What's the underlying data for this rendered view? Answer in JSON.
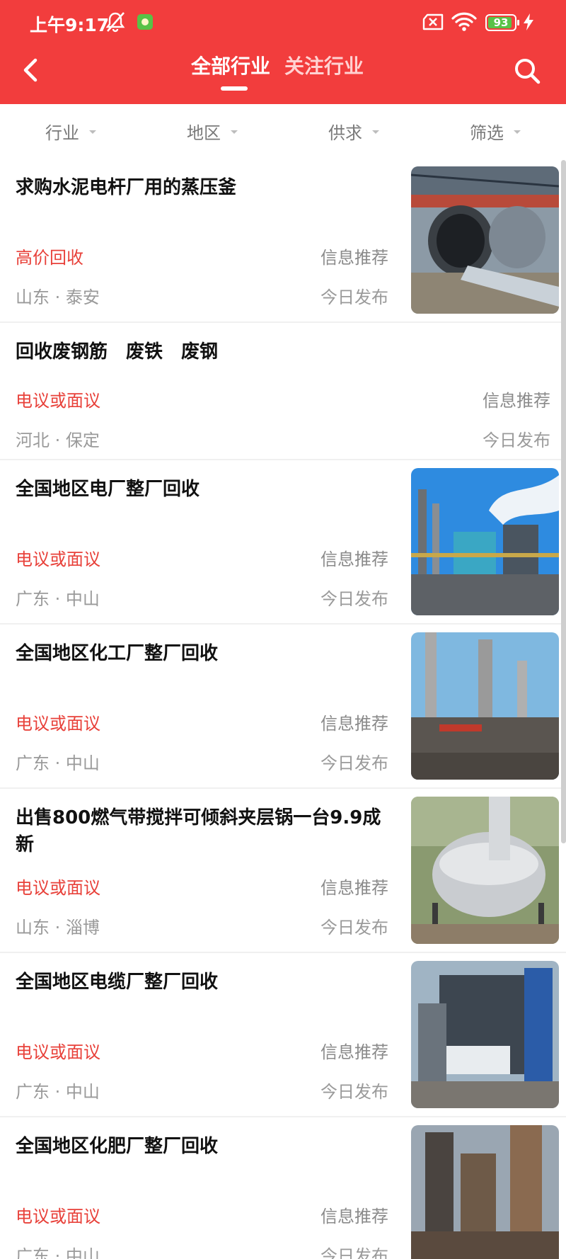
{
  "status_bar": {
    "time": "上午9:17",
    "battery": "93",
    "battery_level": 0.93
  },
  "nav": {
    "tabs": [
      {
        "label": "全部行业"
      },
      {
        "label": "关注行业"
      }
    ]
  },
  "filters": [
    {
      "label": "行业"
    },
    {
      "label": "地区"
    },
    {
      "label": "供求"
    },
    {
      "label": "筛选"
    }
  ],
  "items": [
    {
      "title": "求购水泥电杆厂用的蒸压釜",
      "price": "高价回收",
      "tag": "信息推荐",
      "location": "山东 · 泰安",
      "date": "今日发布",
      "image": "autoclave"
    },
    {
      "title": "回收废钢筋　废铁　废钢",
      "price": "电议或面议",
      "tag": "信息推荐",
      "location": "河北 · 保定",
      "date": "今日发布",
      "image": ""
    },
    {
      "title": "全国地区电厂整厂回收",
      "price": "电议或面议",
      "tag": "信息推荐",
      "location": "广东 · 中山",
      "date": "今日发布",
      "image": "power-plant"
    },
    {
      "title": "全国地区化工厂整厂回收",
      "price": "电议或面议",
      "tag": "信息推荐",
      "location": "广东 · 中山",
      "date": "今日发布",
      "image": "chemical-plant"
    },
    {
      "title": "出售800燃气带搅拌可倾斜夹层锅一台9.9成新",
      "price": "电议或面议",
      "tag": "信息推荐",
      "location": "山东 · 淄博",
      "date": "今日发布",
      "image": "jacketed-kettle"
    },
    {
      "title": "全国地区电缆厂整厂回收",
      "price": "电议或面议",
      "tag": "信息推荐",
      "location": "广东 · 中山",
      "date": "今日发布",
      "image": "cable-plant"
    },
    {
      "title": "全国地区化肥厂整厂回收",
      "price": "电议或面议",
      "tag": "信息推荐",
      "location": "广东 · 中山",
      "date": "今日发布",
      "image": "fertilizer-plant"
    }
  ]
}
